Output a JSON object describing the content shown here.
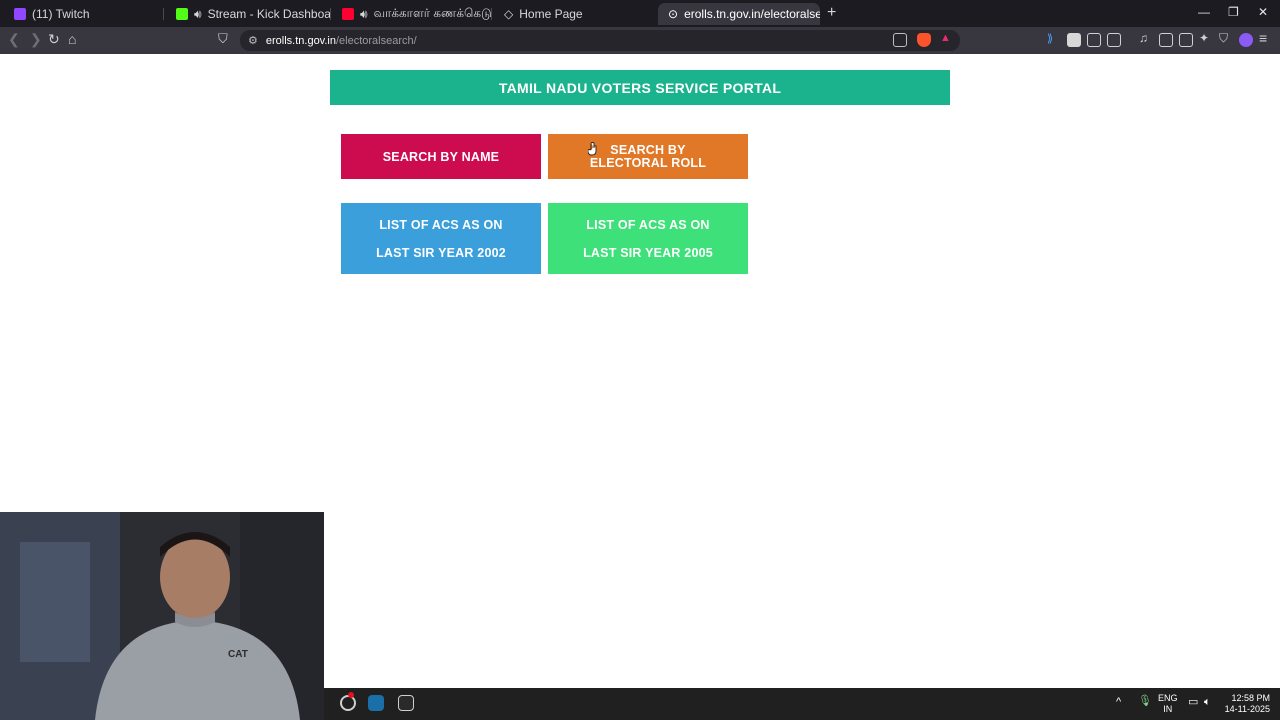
{
  "browser": {
    "tabs": [
      {
        "label": "(11) Twitch",
        "favicon_color": "#9146ff",
        "active": false
      },
      {
        "label": "Stream - Kick Dashboard",
        "favicon_color": "#53fc18",
        "active": false
      },
      {
        "label": "வாக்காளர் கணக்கெடுப் பட",
        "favicon_color": "#ff0033",
        "active": false
      },
      {
        "label": "Home Page",
        "favicon_color": "#aaaaaa",
        "active": false
      },
      {
        "label": "erolls.tn.gov.in/electoralsearch/",
        "favicon_color": "#cccccc",
        "active": true
      }
    ],
    "new_tab": "+",
    "close_tab": "✕",
    "window_controls": {
      "minimize": "—",
      "restore": "❐",
      "close": "✕"
    },
    "url": {
      "host": "erolls.tn.gov.in",
      "path": "/electoralsearch/"
    }
  },
  "page": {
    "title": "TAMIL NADU VOTERS SERVICE PORTAL",
    "buttons": {
      "search_by_name": "SEARCH BY NAME",
      "search_by_roll_line1": "SEARCH BY",
      "search_by_roll_line2": "ELECTORAL ROLL",
      "acs_2002_line1": "LIST OF ACS AS ON",
      "acs_2002_line2": "LAST SIR YEAR 2002",
      "acs_2005_line1": "LIST OF ACS AS ON",
      "acs_2005_line2": "LAST SIR YEAR 2005"
    },
    "colors": {
      "header": "#1bb38d",
      "search_by_name": "#cc0c4f",
      "search_by_roll": "#e07828",
      "acs_2002": "#3a9fdb",
      "acs_2005": "#3ee079"
    }
  },
  "webcam": {
    "shirt_text": "CAT"
  },
  "taskbar": {
    "language_line1": "ENG",
    "language_line2": "IN",
    "time": "12:58 PM",
    "date": "14-11-2025"
  }
}
